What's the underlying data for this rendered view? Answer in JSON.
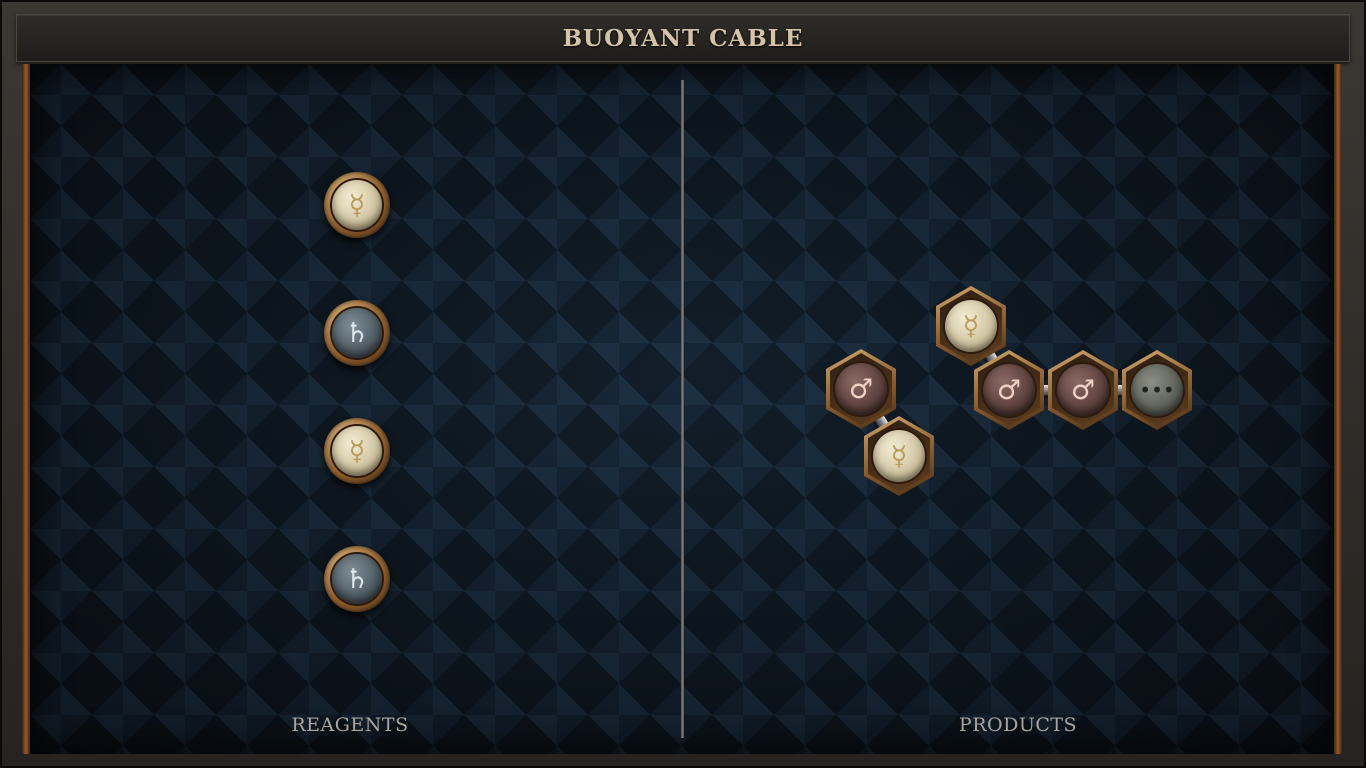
{
  "puzzle": {
    "title": "BUOYANT CABLE"
  },
  "panels": {
    "reagents_label": "REAGENTS",
    "products_label": "PRODUCTS"
  },
  "glyphs": {
    "quicksilver": "☿",
    "lead": "♄",
    "iron": "♂",
    "repeat": "•••"
  },
  "reagents": [
    {
      "element": "quicksilver",
      "icon": "mercury-icon"
    },
    {
      "element": "lead",
      "icon": "saturn-icon"
    },
    {
      "element": "quicksilver",
      "icon": "mercury-icon"
    },
    {
      "element": "lead",
      "icon": "saturn-icon"
    }
  ],
  "products": {
    "molecule_a": [
      {
        "element": "iron",
        "icon": "mars-icon"
      },
      {
        "element": "quicksilver",
        "icon": "mercury-icon"
      }
    ],
    "molecule_b": [
      {
        "element": "quicksilver",
        "icon": "mercury-icon"
      },
      {
        "element": "iron",
        "icon": "mars-icon"
      },
      {
        "element": "iron",
        "icon": "mars-icon"
      },
      {
        "element": "repeat",
        "icon": "ellipsis-icon"
      }
    ]
  },
  "colors": {
    "frame_copper": "#9c5a2c",
    "board_navy": "#152231",
    "title_text": "#d5c3a8",
    "label_text": "#a9a59e"
  }
}
